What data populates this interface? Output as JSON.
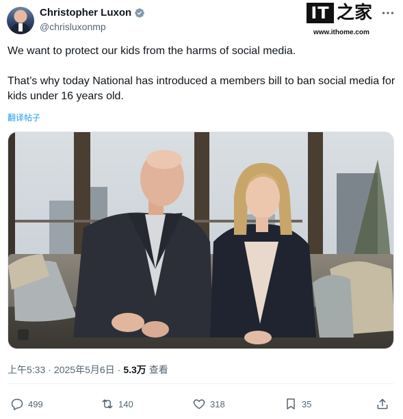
{
  "author": {
    "display_name": "Christopher Luxon",
    "handle": "@chrisluxonmp",
    "verified_icon": "verified-badge-icon"
  },
  "watermark": {
    "logo_letters": "IT",
    "logo_chinese": "之家",
    "url": "www.ithome.com"
  },
  "tweet": {
    "paragraphs": [
      "We want to protect our kids from the harms of social media.",
      "That’s why today National has introduced a members bill to ban social media for kids under 16 years old."
    ],
    "translate_label": "翻译帖子"
  },
  "meta": {
    "time": "上午5:33",
    "separator1": "·",
    "date": "2025年5月6日",
    "separator2": "·",
    "views_count": "5.3万",
    "views_label": "查看"
  },
  "actions": {
    "replies": "499",
    "reposts": "140",
    "likes": "318",
    "bookmarks": "35"
  },
  "colors": {
    "link": "#1d9bf0",
    "secondary_text": "#536471",
    "primary_text": "#0f1419",
    "verified": "#829aab"
  },
  "icons": [
    "more-icon",
    "reply-icon",
    "repost-icon",
    "like-icon",
    "bookmark-icon",
    "share-icon"
  ]
}
